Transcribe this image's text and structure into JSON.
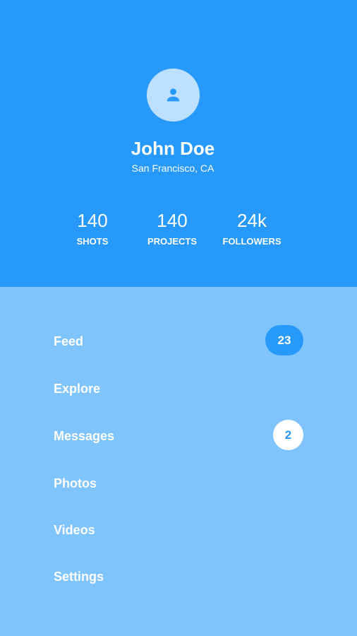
{
  "colors": {
    "header_bg": "#2699fb",
    "menu_bg": "#80c4fe",
    "avatar_bg": "#bce0fd",
    "text": "#ffffff"
  },
  "profile": {
    "avatar_icon": "person-icon",
    "name": "John Doe",
    "location": "San Francisco, CA"
  },
  "stats": [
    {
      "value": "140",
      "label": "SHOTS"
    },
    {
      "value": "140",
      "label": "PROJECTS"
    },
    {
      "value": "24k",
      "label": "FOLLOWERS"
    }
  ],
  "menu": [
    {
      "label": "Feed",
      "badge": "23"
    },
    {
      "label": "Explore"
    },
    {
      "label": "Messages",
      "badge": "2"
    },
    {
      "label": "Photos"
    },
    {
      "label": "Videos"
    },
    {
      "label": "Settings"
    }
  ]
}
